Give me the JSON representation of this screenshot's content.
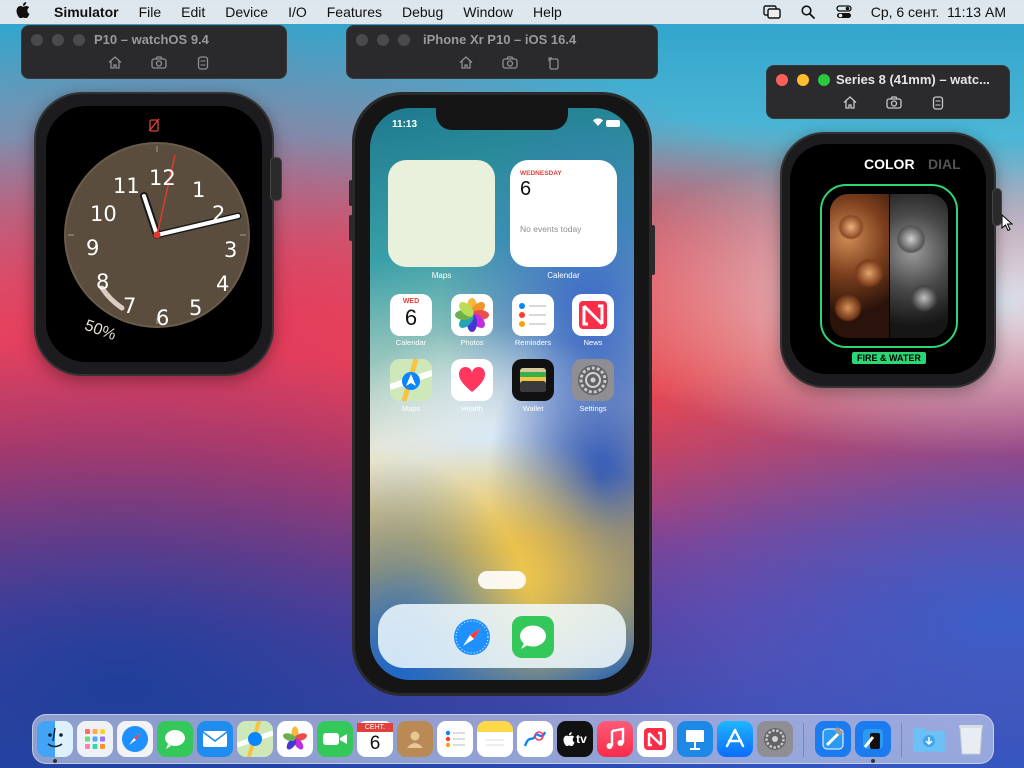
{
  "menubar": {
    "apple": "",
    "app_name": "Simulator",
    "items": [
      "File",
      "Edit",
      "Device",
      "I/O",
      "Features",
      "Debug",
      "Window",
      "Help"
    ],
    "datetime": "Ср, 6 сент.  11:13 AM"
  },
  "sims": {
    "watch1_title": "P10 – watchOS 9.4",
    "phone_title": "iPhone Xr P10 – iOS 16.4",
    "watch2_title": "Series 8 (41mm) – watc..."
  },
  "watch1": {
    "battery_text": "50%",
    "numerals": [
      "12",
      "1",
      "2",
      "3",
      "4",
      "5",
      "6",
      "7",
      "8",
      "9",
      "10",
      "11"
    ]
  },
  "watch2": {
    "tab_color": "COLOR",
    "tab_dial": "DIAL",
    "face_name": "FIRE & WATER"
  },
  "phone": {
    "time": "11:13",
    "maps_widget_label": "Maps",
    "calendar_widget": {
      "day_name": "WEDNESDAY",
      "day_num": "6",
      "events": "No events today",
      "label": "Calendar"
    },
    "apps_row1": [
      {
        "label": "Calendar",
        "icon": "calendar-icon",
        "top": "WED",
        "num": "6"
      },
      {
        "label": "Photos",
        "icon": "photos-icon"
      },
      {
        "label": "Reminders",
        "icon": "reminders-icon"
      },
      {
        "label": "News",
        "icon": "news-icon"
      }
    ],
    "apps_row2": [
      {
        "label": "Maps",
        "icon": "maps-icon"
      },
      {
        "label": "Health",
        "icon": "health-icon"
      },
      {
        "label": "Wallet",
        "icon": "wallet-icon"
      },
      {
        "label": "Settings",
        "icon": "settings-icon"
      }
    ],
    "dock": [
      "safari-icon",
      "messages-icon"
    ]
  },
  "dock": {
    "calendar_month": "СЕНТ.",
    "calendar_day": "6",
    "tv_label": "tv",
    "apps": [
      "Finder",
      "Launchpad",
      "Safari",
      "Messages",
      "Mail",
      "Maps",
      "Photos",
      "FaceTime",
      "Calendar",
      "Contacts",
      "Reminders",
      "Notes",
      "Freeform",
      "TV",
      "Music",
      "News",
      "Keynote",
      "App Store",
      "System Settings",
      "Xcode",
      "Simulator",
      "Downloads",
      "Trash"
    ]
  }
}
